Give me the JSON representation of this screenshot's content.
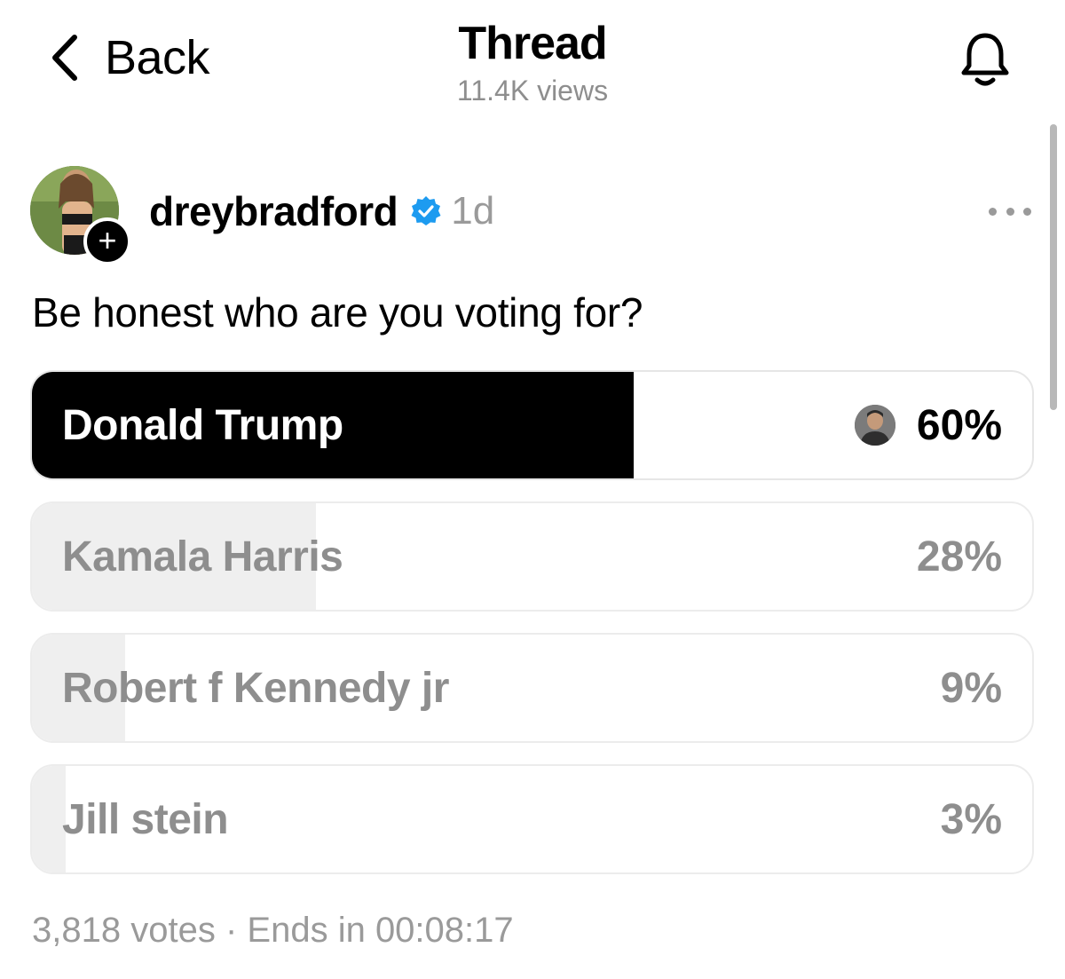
{
  "header": {
    "back_label": "Back",
    "title": "Thread",
    "views": "11.4K views",
    "back_icon": "chevron-left-icon",
    "bell_icon": "bell-icon"
  },
  "post": {
    "username": "dreybradford",
    "verified": true,
    "age": "1d",
    "follow_badge": "+",
    "question": "Be honest who are you voting for?",
    "more_icon": "more-dots-icon"
  },
  "poll": {
    "options": [
      {
        "label": "Donald Trump",
        "percent_text": "60%",
        "percent": 60,
        "selected": true,
        "voter_avatar": true
      },
      {
        "label": "Kamala Harris",
        "percent_text": "28%",
        "percent": 28,
        "selected": false,
        "voter_avatar": false
      },
      {
        "label": "Robert f Kennedy jr",
        "percent_text": "9%",
        "percent": 9,
        "selected": false,
        "voter_avatar": false
      },
      {
        "label": "Jill stein",
        "percent_text": "3%",
        "percent": 3,
        "selected": false,
        "voter_avatar": false
      }
    ],
    "votes": "3,818 votes",
    "separator": "·",
    "ends": "Ends in 00:08:17"
  },
  "colors": {
    "selected_fill": "#000000",
    "unselected_fill": "#efefef",
    "muted_text": "#8e8e8e",
    "verified_blue": "#1d9bf0"
  }
}
